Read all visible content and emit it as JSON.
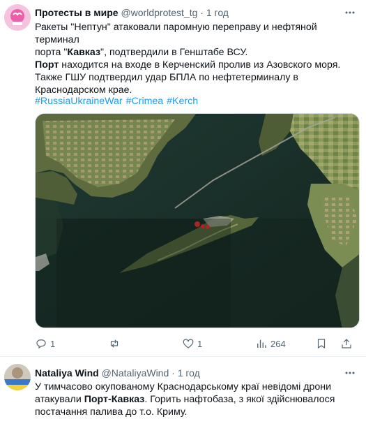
{
  "tweet1": {
    "author_name": "Протесты в мире",
    "handle": "@worldprotest_tg",
    "separator": "·",
    "time": "1 год",
    "text": {
      "line1": "Ракеты \"Нептун\" атаковали паромную переправу и нефтяной терминал",
      "line2_pre": "порта \"",
      "line2_bold": "Кавказ",
      "line2_post": "\", подтвердили в Генштабе ВСУ.",
      "line3_bold": "Порт",
      "line3_post": " находится на входе в Керченский пролив из Азовского моря.",
      "line4": "Также ГШУ подтвердил удар БПЛА по нефтетерминалу в",
      "line5": "Краснодарском крае."
    },
    "hashtags": [
      "#RussiaUkraineWar",
      "#Crimea",
      "#Kerch"
    ],
    "actions": {
      "reply_count": "1",
      "retweet_count": "",
      "like_count": "1",
      "views_count": "264"
    },
    "icons": {
      "more": "more-icon",
      "reply": "reply-icon",
      "retweet": "retweet-icon",
      "like": "heart-icon",
      "views": "views-icon",
      "bookmark": "bookmark-icon",
      "share": "share-icon"
    }
  },
  "tweet2": {
    "author_name": "Nataliya Wind",
    "handle": "@NataliyaWind",
    "separator": "·",
    "time": "1 год",
    "text": {
      "line1": "У тимчасово окупованому Краснодарському краї невідомі дрони",
      "line2_pre": "атакували ",
      "line2_bold": "Порт-Кавказ",
      "line2_post": ". Горить нафтобаза, з якої здійснювалося",
      "line3": "постачання палива до т.о. Криму."
    }
  },
  "colors": {
    "accent": "#1d9bf0",
    "muted": "#536471",
    "text": "#0f1419",
    "fire": "#ff2a2a"
  }
}
